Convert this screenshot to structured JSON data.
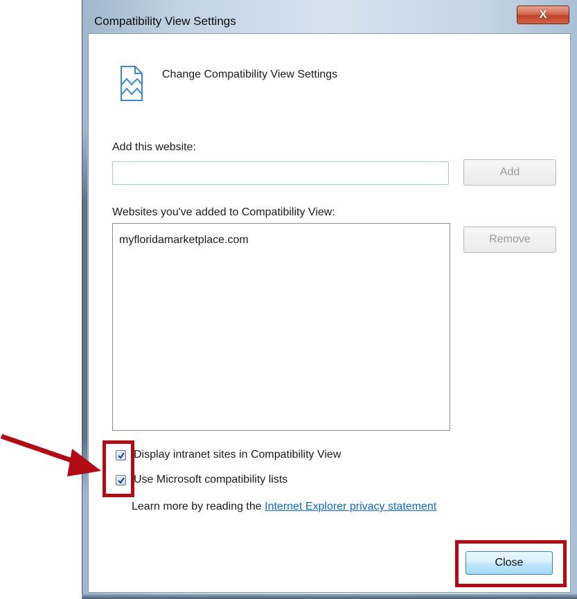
{
  "window": {
    "title": "Compatibility View Settings",
    "close_glyph": "X"
  },
  "header": {
    "icon": "compatibility-view-icon",
    "text": "Change Compatibility View Settings"
  },
  "add_section": {
    "label": "Add this website:",
    "input_value": "",
    "add_button": "Add"
  },
  "list_section": {
    "label": "Websites you've added to Compatibility View:",
    "items": [
      "myfloridamarketplace.com"
    ],
    "remove_button": "Remove"
  },
  "options": [
    {
      "label": "Display intranet sites in Compatibility View",
      "checked": true
    },
    {
      "label": "Use Microsoft compatibility lists",
      "checked": true
    }
  ],
  "learn_more": {
    "prefix": "Learn more by reading the ",
    "link": "Internet Explorer privacy statement"
  },
  "footer": {
    "close_button": "Close"
  },
  "annotations": {
    "highlight_color": "#b10c16",
    "arrow_icon": "arrow-right-icon"
  }
}
